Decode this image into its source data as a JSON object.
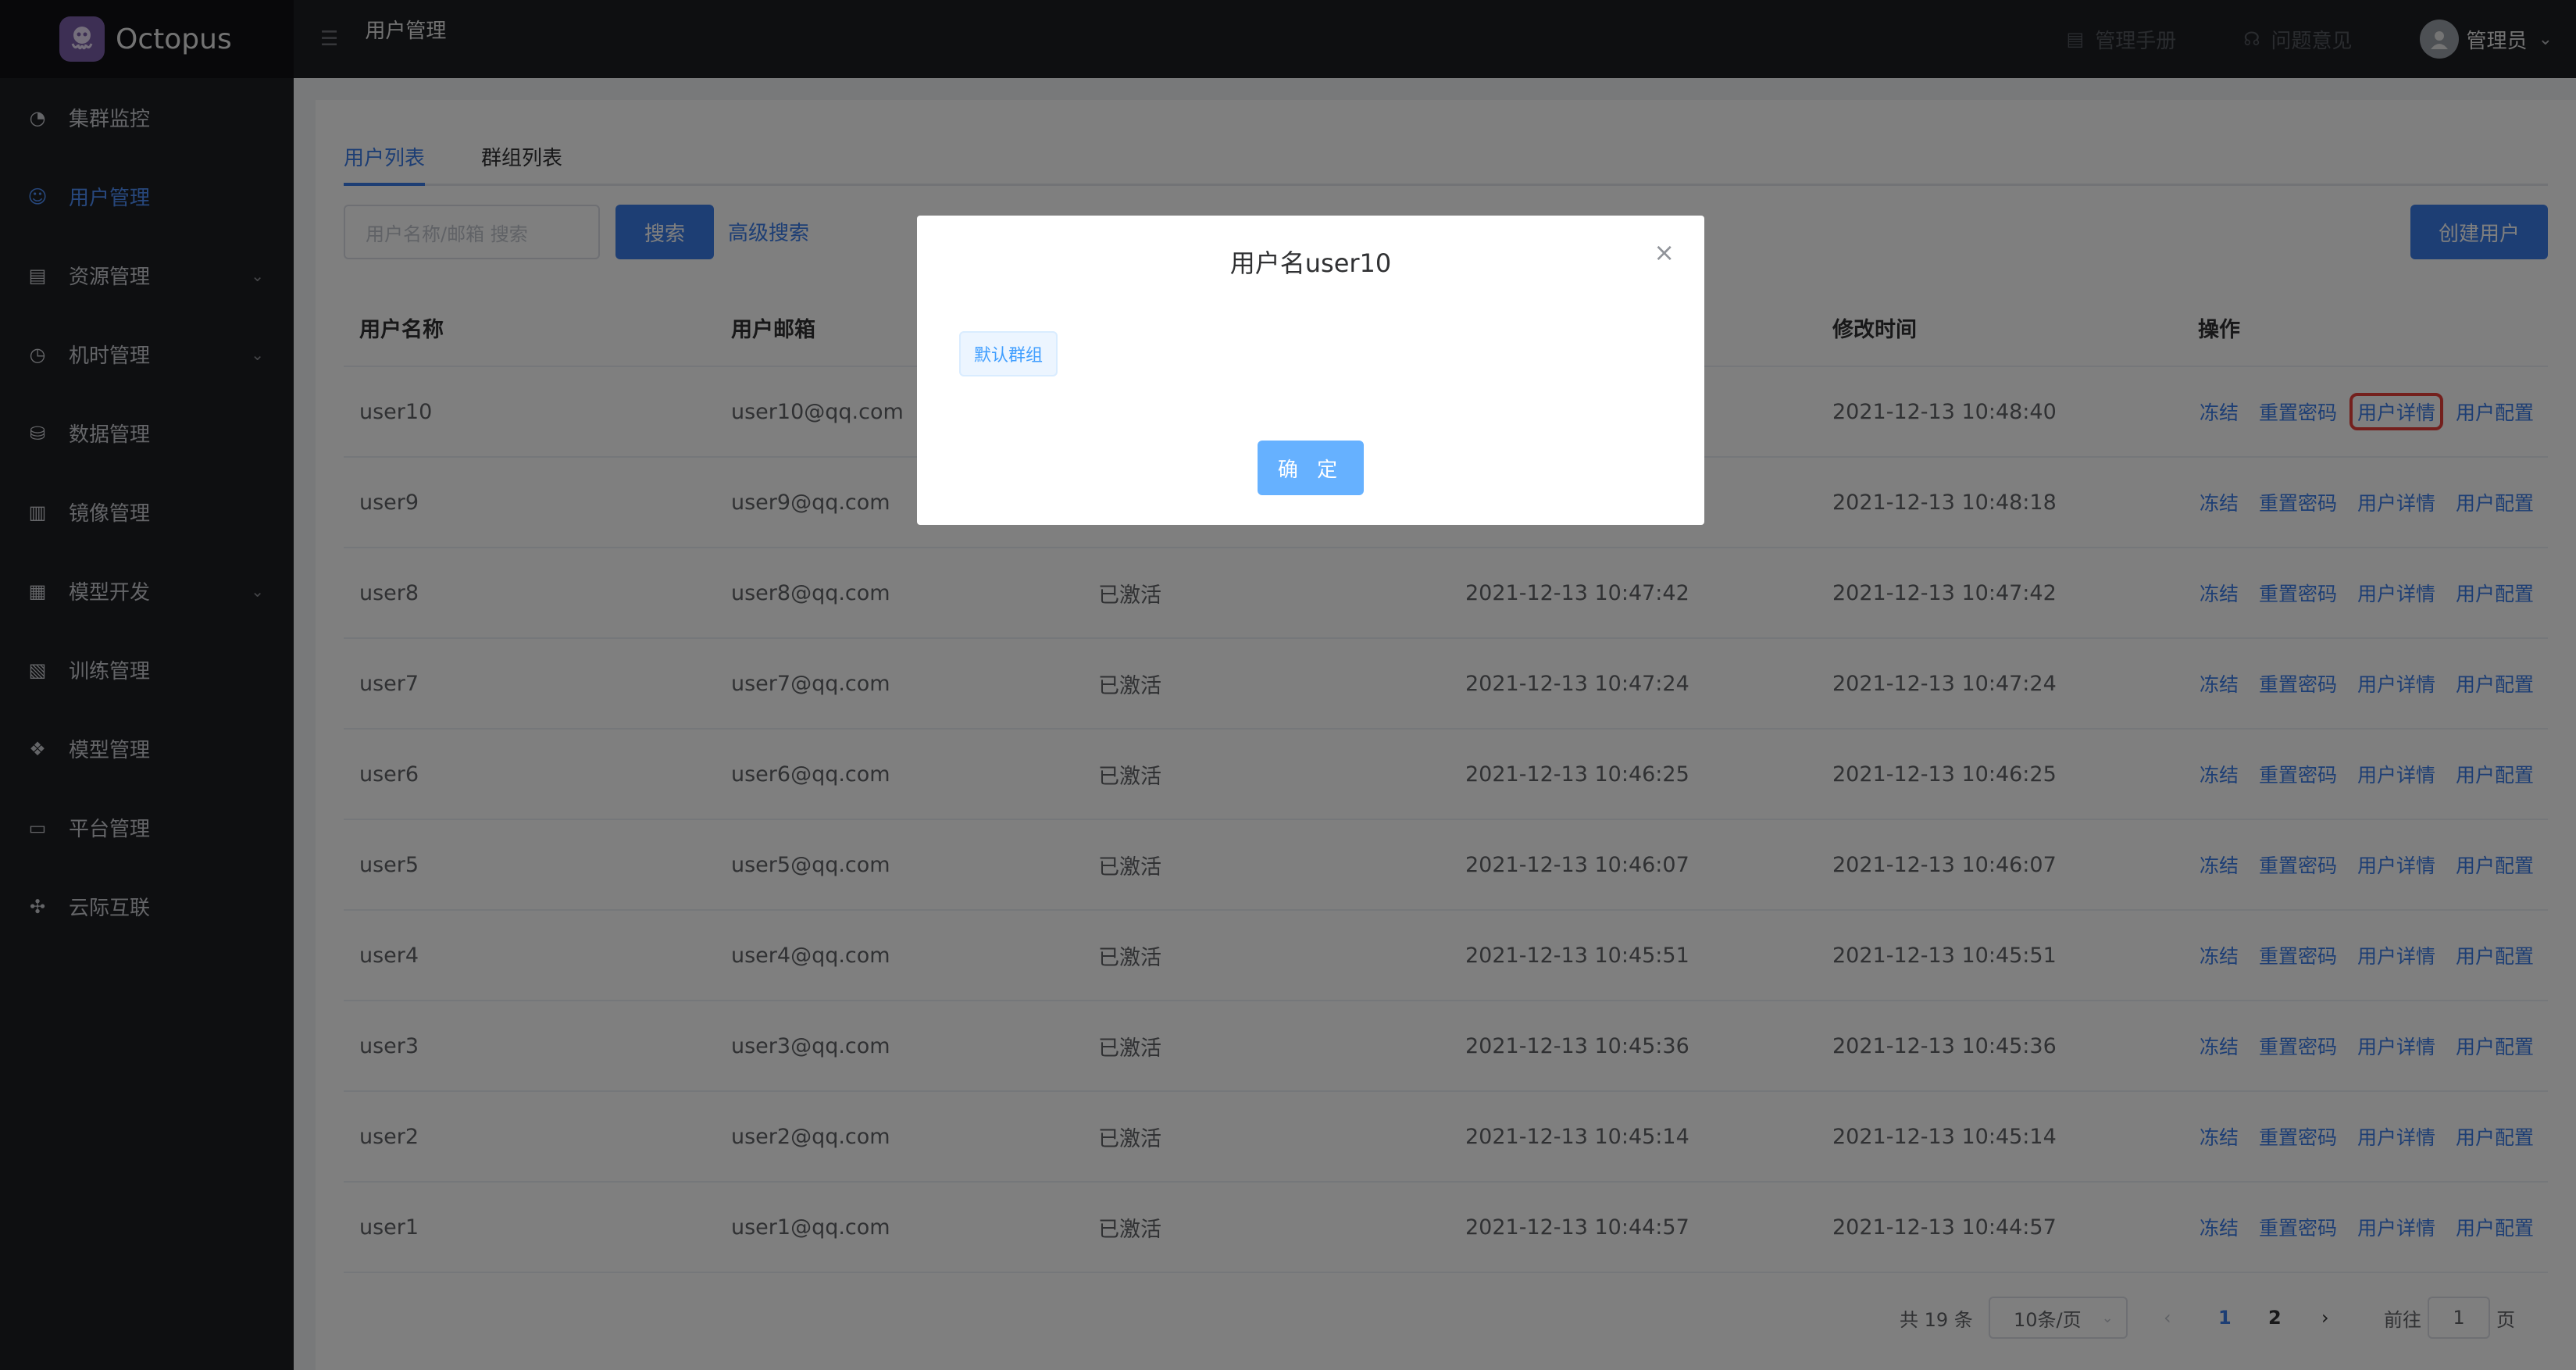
{
  "app": {
    "name": "Octopus"
  },
  "sidebar": {
    "items": [
      {
        "label": "集群监控",
        "icon": "dashboard-icon",
        "active": false,
        "expandable": false
      },
      {
        "label": "用户管理",
        "icon": "user-icon",
        "active": true,
        "expandable": false
      },
      {
        "label": "资源管理",
        "icon": "clipboard-icon",
        "active": false,
        "expandable": true
      },
      {
        "label": "机时管理",
        "icon": "clock-icon",
        "active": false,
        "expandable": true
      },
      {
        "label": "数据管理",
        "icon": "database-icon",
        "active": false,
        "expandable": false
      },
      {
        "label": "镜像管理",
        "icon": "book-icon",
        "active": false,
        "expandable": false
      },
      {
        "label": "模型开发",
        "icon": "grid-icon",
        "active": false,
        "expandable": true
      },
      {
        "label": "训练管理",
        "icon": "document-icon",
        "active": false,
        "expandable": false
      },
      {
        "label": "模型管理",
        "icon": "cube-icon",
        "active": false,
        "expandable": false
      },
      {
        "label": "平台管理",
        "icon": "monitor-icon",
        "active": false,
        "expandable": false
      },
      {
        "label": "云际互联",
        "icon": "network-icon",
        "active": false,
        "expandable": false
      }
    ]
  },
  "header": {
    "title": "用户管理",
    "manual": "管理手册",
    "feedback": "问题意见",
    "user": "管理员"
  },
  "tabs": [
    "用户列表",
    "群组列表"
  ],
  "search": {
    "placeholder": "用户名称/邮箱 搜索",
    "button": "搜索",
    "advanced": "高级搜索",
    "create": "创建用户"
  },
  "table": {
    "headers": [
      "用户名称",
      "用户邮箱",
      "",
      "",
      "修改时间",
      "操作"
    ],
    "rows": [
      {
        "name": "user10",
        "email": "user10@qq.com",
        "status": "",
        "created": "",
        "modified": "2021-12-13 10:48:40"
      },
      {
        "name": "user9",
        "email": "user9@qq.com",
        "status": "",
        "created": "",
        "modified": "2021-12-13 10:48:18"
      },
      {
        "name": "user8",
        "email": "user8@qq.com",
        "status": "已激活",
        "created": "2021-12-13 10:47:42",
        "modified": "2021-12-13 10:47:42"
      },
      {
        "name": "user7",
        "email": "user7@qq.com",
        "status": "已激活",
        "created": "2021-12-13 10:47:24",
        "modified": "2021-12-13 10:47:24"
      },
      {
        "name": "user6",
        "email": "user6@qq.com",
        "status": "已激活",
        "created": "2021-12-13 10:46:25",
        "modified": "2021-12-13 10:46:25"
      },
      {
        "name": "user5",
        "email": "user5@qq.com",
        "status": "已激活",
        "created": "2021-12-13 10:46:07",
        "modified": "2021-12-13 10:46:07"
      },
      {
        "name": "user4",
        "email": "user4@qq.com",
        "status": "已激活",
        "created": "2021-12-13 10:45:51",
        "modified": "2021-12-13 10:45:51"
      },
      {
        "name": "user3",
        "email": "user3@qq.com",
        "status": "已激活",
        "created": "2021-12-13 10:45:36",
        "modified": "2021-12-13 10:45:36"
      },
      {
        "name": "user2",
        "email": "user2@qq.com",
        "status": "已激活",
        "created": "2021-12-13 10:45:14",
        "modified": "2021-12-13 10:45:14"
      },
      {
        "name": "user1",
        "email": "user1@qq.com",
        "status": "已激活",
        "created": "2021-12-13 10:44:57",
        "modified": "2021-12-13 10:44:57"
      }
    ],
    "actions": [
      "冻结",
      "重置密码",
      "用户详情",
      "用户配置"
    ]
  },
  "pagination": {
    "total": "共 19 条",
    "page_size": "10条/页",
    "pages": [
      "1",
      "2"
    ],
    "current": "1",
    "goto_label": "前往",
    "goto_value": "1",
    "page_suffix": "页"
  },
  "dialog": {
    "title": "用户名user10",
    "tag": "默认群组",
    "confirm": "确 定"
  },
  "colors": {
    "accent": "#3b7ce8",
    "highlight": "#e8413a",
    "sidebar": "#1d1e23"
  }
}
